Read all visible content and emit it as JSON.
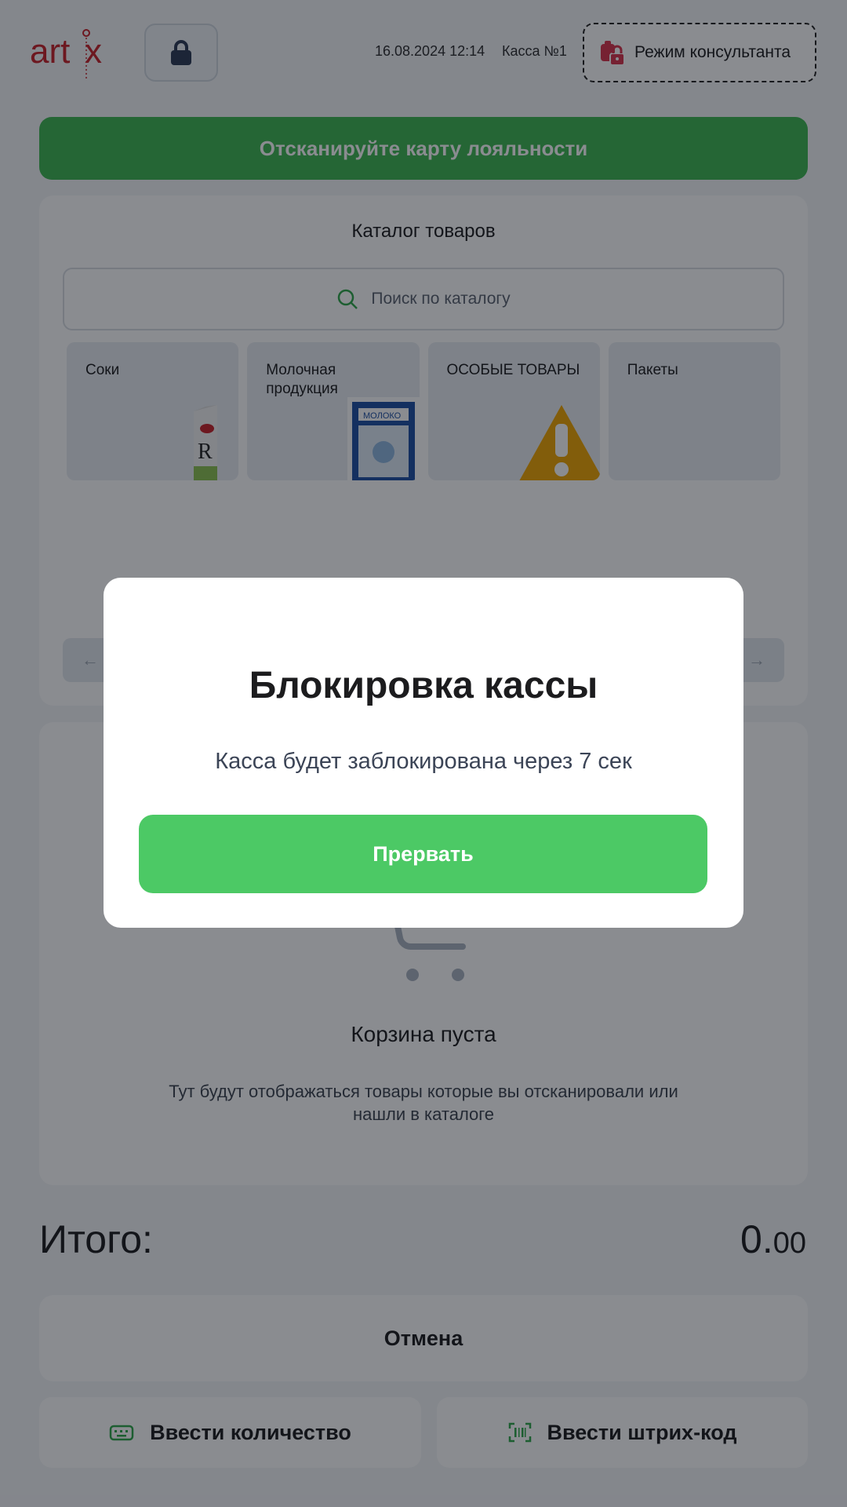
{
  "header": {
    "datetime": "16.08.2024 12:14",
    "register": "Касса №1",
    "consultant_mode": "Режим консультанта"
  },
  "loyalty": {
    "label": "Отсканируйте карту лояльности"
  },
  "catalog": {
    "title": "Каталог товаров",
    "search_placeholder": "Поиск по каталогу",
    "categories": [
      {
        "label": "Соки"
      },
      {
        "label": "Молочная продукция"
      },
      {
        "label": "ОСОБЫЕ ТОВАРЫ"
      },
      {
        "label": "Пакеты"
      }
    ]
  },
  "cart": {
    "title": "Корзина пуста",
    "subtitle": "Тут будут отображаться товары которые вы отсканировали или нашли в каталоге"
  },
  "totals": {
    "label": "Итого:",
    "value_int": "0.",
    "value_dec": "00"
  },
  "actions": {
    "cancel": "Отмена",
    "enter_quantity": "Ввести количество",
    "enter_barcode": "Ввести штрих-код"
  },
  "modal": {
    "title": "Блокировка кассы",
    "text": "Касса будет заблокирована через 7 сек",
    "button": "Прервать"
  },
  "colors": {
    "accent_green": "#4cc965",
    "brand_red": "#c7222a"
  }
}
